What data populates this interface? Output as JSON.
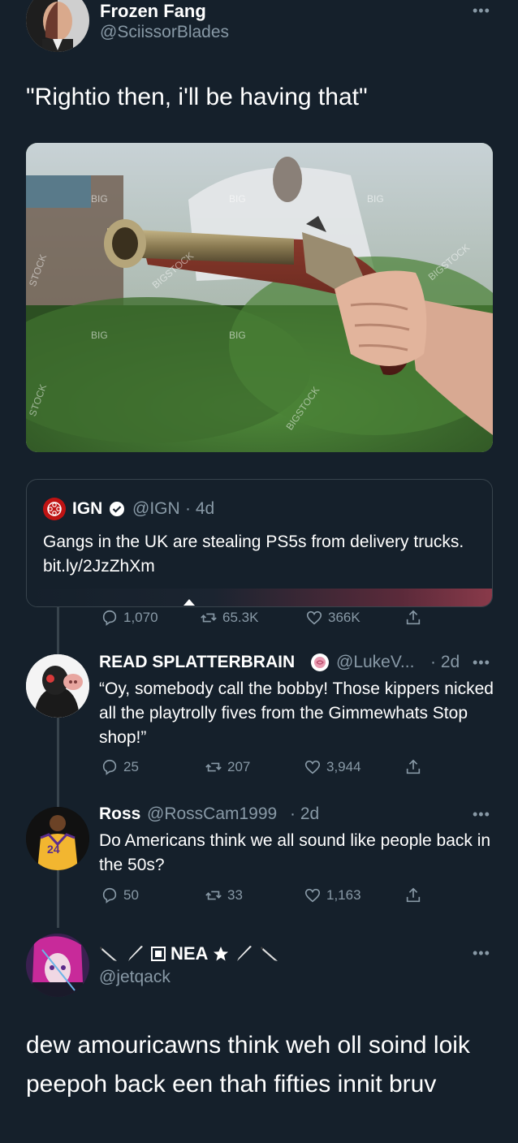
{
  "main_tweet": {
    "name": "Frozen Fang",
    "handle": "@SciissorBlades",
    "text": "\"Rightio then, i'll be having that\"",
    "more": "•••"
  },
  "photo": {
    "watermarks": [
      "BIG",
      "BIG",
      "BIG",
      "BIG",
      "BIG",
      "BIGSTOCK",
      "BIGSTOCK",
      "BIGSTOCK",
      "STOCK",
      "STOCK"
    ]
  },
  "quoted": {
    "name": "IGN",
    "handle": "@IGN",
    "time": "· 4d",
    "text": "Gangs in the UK are stealing PS5s from delivery trucks. bit.ly/2JzZhXm"
  },
  "main_actions": {
    "replies": "1,070",
    "retweets": "65.3K",
    "likes": "366K"
  },
  "replies": [
    {
      "name": "READ SPLATTERBRAIN",
      "handle": "@LukeV...",
      "time": "· 2d",
      "text": "“Oy, somebody call the bobby! Those kippers nicked all the playtrolly fives from the Gimmewhats Stop shop!”",
      "replies": "25",
      "retweets": "207",
      "likes": "3,944"
    },
    {
      "name": "Ross",
      "handle": "@RossCam1999",
      "time": "· 2d",
      "text": "Do Americans think we all sound like people back in the 50s?",
      "replies": "50",
      "retweets": "33",
      "likes": "1,163",
      "jersey": "24"
    }
  ],
  "last_tweet": {
    "name": "NEA",
    "handle": "@jetqack",
    "text": "dew amouricawns think weh oll soind loik peepoh back een thah fifties innit bruv"
  },
  "colors": {
    "background": "#15202b",
    "muted": "#8899a6",
    "border": "#38444d",
    "ign_red": "#bf1313"
  }
}
